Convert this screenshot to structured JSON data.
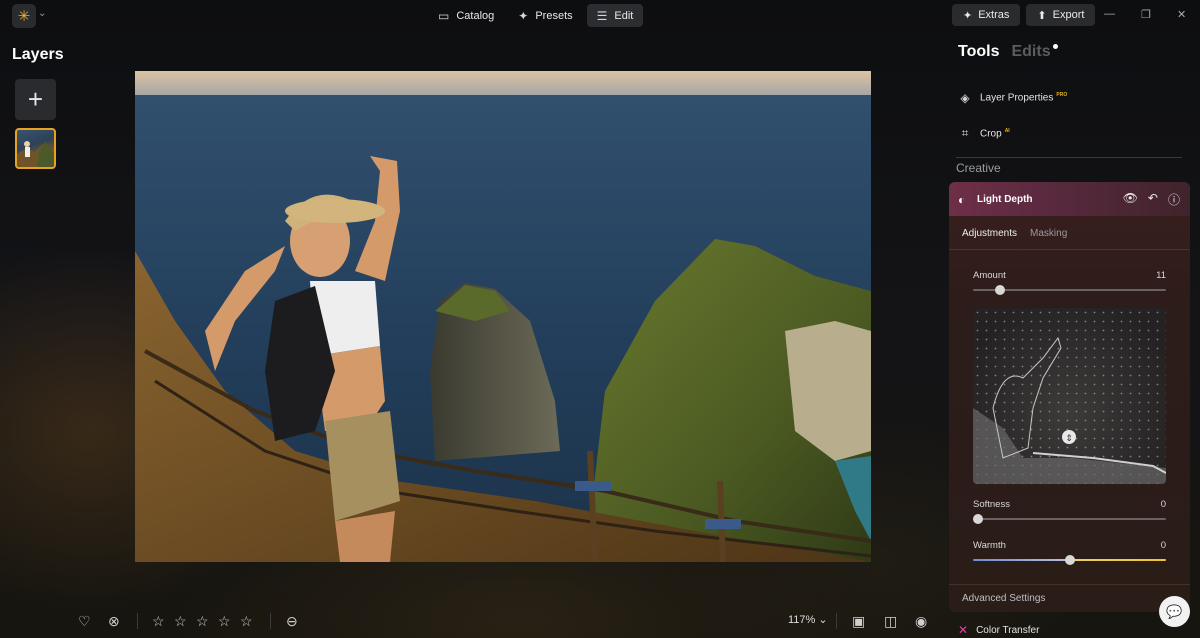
{
  "topbar": {
    "catalog_label": "Catalog",
    "presets_label": "Presets",
    "edit_label": "Edit",
    "extras_label": "Extras",
    "export_label": "Export"
  },
  "layers": {
    "title": "Layers"
  },
  "bottom": {
    "rating_max": 5,
    "zoom": "117%"
  },
  "tools_panel": {
    "tab_tools": "Tools",
    "tab_edits": "Edits",
    "layer_properties": "Layer Properties",
    "layer_properties_badge": "PRO",
    "crop": "Crop",
    "crop_badge": "AI",
    "section_creative": "Creative",
    "light_depth": {
      "title": "Light Depth",
      "tab_adjustments": "Adjustments",
      "tab_masking": "Masking",
      "amount_label": "Amount",
      "amount_value": "11",
      "softness_label": "Softness",
      "softness_value": "0",
      "warmth_label": "Warmth",
      "warmth_value": "0",
      "advanced_settings": "Advanced Settings"
    },
    "color_transfer": "Color Transfer"
  },
  "colors": {
    "accent_orange": "#e9a21f",
    "panel_header": "#6e2f48",
    "badge_gold": "#e6b21a"
  }
}
